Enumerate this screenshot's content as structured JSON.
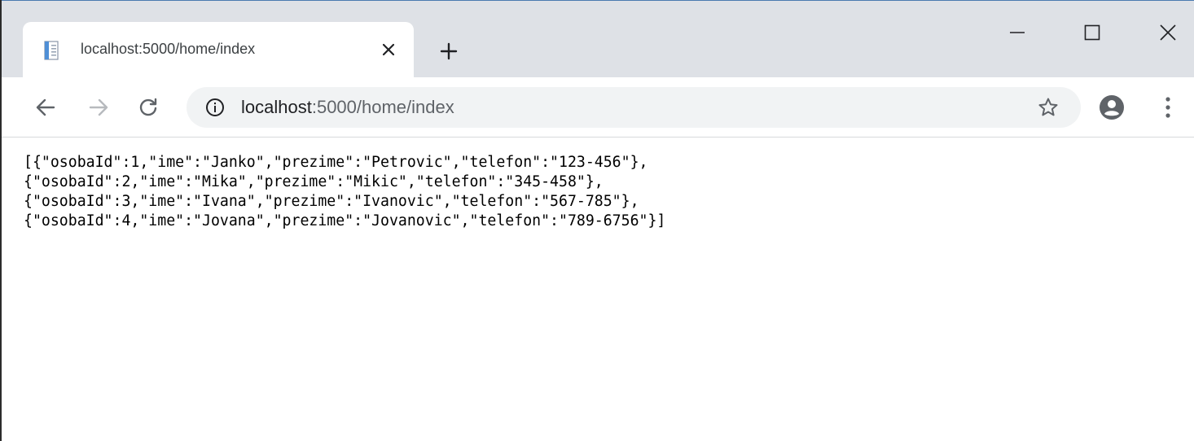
{
  "tab": {
    "title": "localhost:5000/home/index"
  },
  "omnibox": {
    "host": "localhost",
    "path": ":5000/home/index"
  },
  "page": {
    "lines": [
      "[{\"osobaId\":1,\"ime\":\"Janko\",\"prezime\":\"Petrovic\",\"telefon\":\"123-456\"},",
      "{\"osobaId\":2,\"ime\":\"Mika\",\"prezime\":\"Mikic\",\"telefon\":\"345-458\"},",
      "{\"osobaId\":3,\"ime\":\"Ivana\",\"prezime\":\"Ivanovic\",\"telefon\":\"567-785\"},",
      "{\"osobaId\":4,\"ime\":\"Jovana\",\"prezime\":\"Jovanovic\",\"telefon\":\"789-6756\"}]"
    ]
  },
  "icons": {
    "favicon": "document-icon",
    "tab_close": "close-icon",
    "new_tab": "plus-icon",
    "minimize": "minimize-icon",
    "maximize": "maximize-icon",
    "close_window": "close-icon",
    "back": "back-arrow-icon",
    "forward": "forward-arrow-icon",
    "reload": "reload-icon",
    "site_info": "info-icon",
    "bookmark": "star-icon",
    "profile": "account-icon",
    "menu": "more-vert-icon"
  },
  "colors": {
    "tabstrip": "#dee1e6",
    "omnibox": "#f1f3f4",
    "icon": "#5f6368",
    "text": "#202124"
  }
}
